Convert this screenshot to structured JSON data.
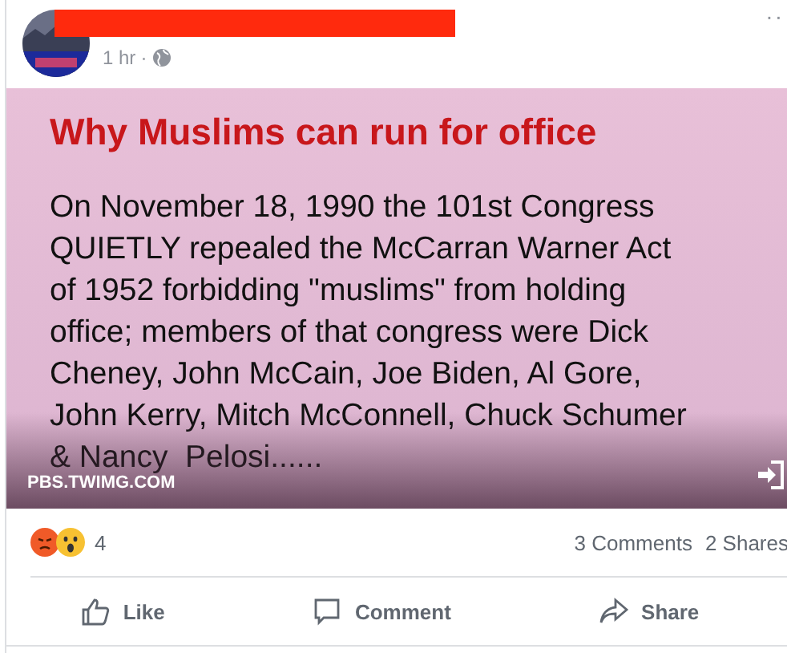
{
  "post": {
    "time": "1 hr",
    "separator": "·",
    "more": "··"
  },
  "image": {
    "title": "Why Muslims can run for office",
    "lines": [
      "On November 18, 1990 the 101st Congress",
      "QUIETLY repealed the McCarran Warner Act",
      "of 1952 forbidding \"muslims\" from holding",
      "office; members of that congress were Dick",
      "Cheney, John McCain, Joe Biden, Al Gore,",
      "John Kerry, Mitch McConnell, Chuck Schumer",
      "& Nancy  Pelosi......"
    ],
    "source": "PBS.TWIMG.COM"
  },
  "reactions": {
    "count": "4",
    "comments": "3 Comments",
    "shares": "2 Shares"
  },
  "actions": [
    {
      "kind": "like",
      "label": "Like"
    },
    {
      "kind": "comment",
      "label": "Comment"
    },
    {
      "kind": "share",
      "label": "Share"
    }
  ]
}
